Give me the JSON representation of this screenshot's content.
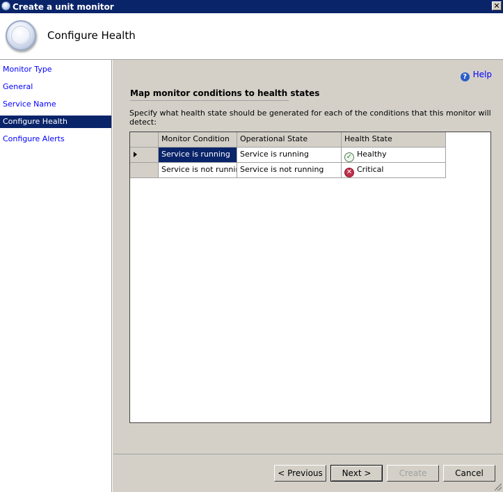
{
  "window": {
    "title": "Create a unit monitor"
  },
  "header": {
    "title": "Configure Health"
  },
  "sidebar": {
    "items": [
      {
        "label": "Monitor Type"
      },
      {
        "label": "General"
      },
      {
        "label": "Service Name"
      },
      {
        "label": "Configure Health",
        "active": true
      },
      {
        "label": "Configure Alerts"
      }
    ]
  },
  "help": {
    "label": "Help"
  },
  "main": {
    "section_title": "Map monitor conditions to health states",
    "description": "Specify what health state should be generated for each of the conditions that this monitor will detect:"
  },
  "table": {
    "columns": [
      "Monitor Condition",
      "Operational State",
      "Health State"
    ],
    "rows": [
      {
        "condition": "Service is running",
        "operational": "Service is running",
        "health": "Healthy",
        "health_icon": "healthy-check-icon",
        "selected": true
      },
      {
        "condition": "Service is not running",
        "operational": "Service is not running",
        "health": "Critical",
        "health_icon": "critical-x-icon",
        "selected": false
      }
    ]
  },
  "buttons": {
    "previous": "< Previous",
    "next": "Next >",
    "create": "Create",
    "cancel": "Cancel"
  },
  "colors": {
    "selection": "#0a246a",
    "link": "#0000ff",
    "face": "#d4d0c8"
  }
}
